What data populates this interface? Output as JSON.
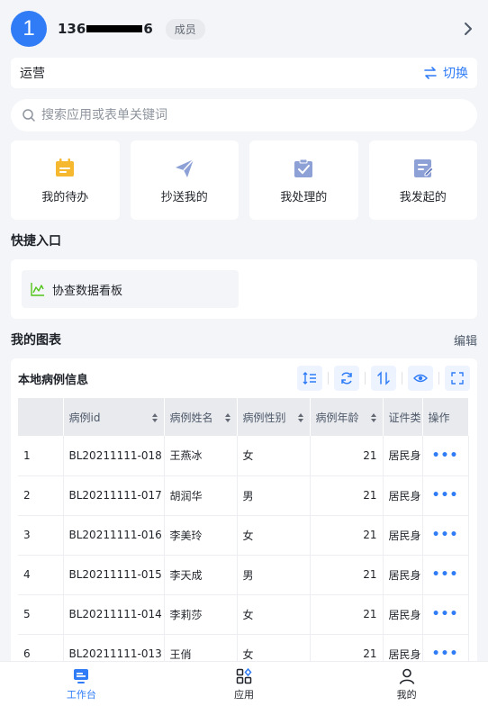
{
  "header": {
    "avatar_text": "1",
    "phone_prefix": "136",
    "phone_suffix": "6",
    "role_badge": "成员"
  },
  "org": {
    "name": "运营",
    "switch_label": "切换"
  },
  "search": {
    "placeholder": "搜索应用或表单关键词"
  },
  "cards": [
    {
      "label": "我的待办",
      "icon": "calendar-icon",
      "color": "#f5b82e"
    },
    {
      "label": "抄送我的",
      "icon": "paper-plane-icon",
      "color": "#8ea1d6"
    },
    {
      "label": "我处理的",
      "icon": "checked-box-icon",
      "color": "#8ea1d6"
    },
    {
      "label": "我发起的",
      "icon": "edit-document-icon",
      "color": "#8ea1d6"
    }
  ],
  "quick_entry": {
    "title": "快捷入口",
    "items": [
      {
        "label": "协查数据看板",
        "icon": "line-chart-icon"
      }
    ]
  },
  "my_charts": {
    "title": "我的图表",
    "edit_label": "编辑",
    "chart_name": "本地病例信息",
    "columns": [
      "",
      "病例id",
      "病例姓名",
      "病例性别",
      "病例年龄",
      "证件类",
      "操作"
    ],
    "rows": [
      {
        "index": "1",
        "id": "BL20211111-018",
        "name": "王燕冰",
        "gender": "女",
        "age": "21",
        "doc": "居民身"
      },
      {
        "index": "2",
        "id": "BL20211111-017",
        "name": "胡润华",
        "gender": "男",
        "age": "21",
        "doc": "居民身"
      },
      {
        "index": "3",
        "id": "BL20211111-016",
        "name": "李美玲",
        "gender": "女",
        "age": "21",
        "doc": "居民身"
      },
      {
        "index": "4",
        "id": "BL20211111-015",
        "name": "李天成",
        "gender": "男",
        "age": "21",
        "doc": "居民身"
      },
      {
        "index": "5",
        "id": "BL20211111-014",
        "name": "李莉莎",
        "gender": "女",
        "age": "21",
        "doc": "居民身"
      },
      {
        "index": "6",
        "id": "BL20211111-013",
        "name": "王俏",
        "gender": "女",
        "age": "21",
        "doc": "居民身"
      }
    ],
    "row_action": "•••"
  },
  "tabbar": [
    {
      "label": "工作台",
      "icon": "workbench-icon",
      "active": true
    },
    {
      "label": "应用",
      "icon": "apps-icon",
      "active": false
    },
    {
      "label": "我的",
      "icon": "user-icon",
      "active": false
    }
  ],
  "colors": {
    "accent": "#2f7cf6",
    "background": "#f3f5f8"
  }
}
